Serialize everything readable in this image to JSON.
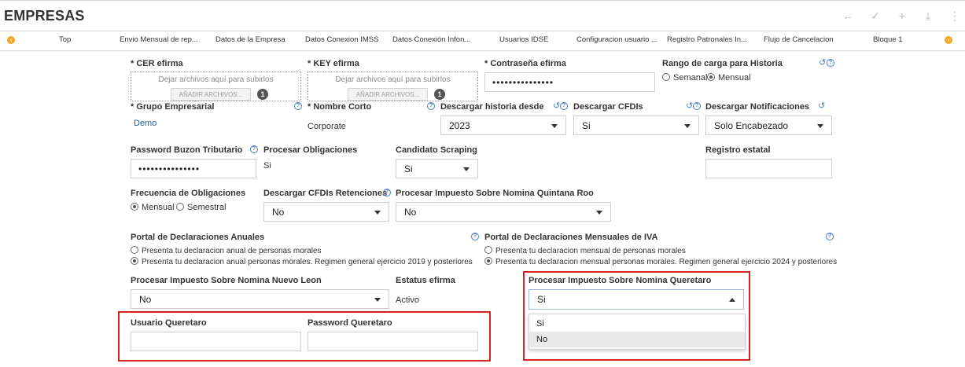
{
  "header": {
    "title": "EMPRESAS",
    "icons": [
      "arrow-left-icon",
      "check-icon",
      "plus-icon",
      "download-icon",
      "more-vertical-icon"
    ]
  },
  "tabs": [
    "Top",
    "Envio Mensual de rep...",
    "Datos de la Empresa",
    "Datos Conexion IMSS",
    "Datos Conexión Infon...",
    "Usuarios IDSE",
    "Configuracion usuario ...",
    "Registro Patronales In...",
    "Flujo de Cancelacion",
    "Bloque 1"
  ],
  "form": {
    "cer": {
      "label": "* CER efirma",
      "drop_text": "Dejar archivos aquí para subirlos",
      "button": "AÑADIR ARCHIVOS...",
      "count": "1"
    },
    "key": {
      "label": "* KEY efirma",
      "drop_text": "Dejar archivos aquí para subirlos",
      "button": "AÑADIR ARCHIVOS...",
      "count": "1"
    },
    "contrasena": {
      "label": "* Contraseña efirma",
      "value": "•••••••••••••••"
    },
    "rango": {
      "label": "Rango de carga para Historia",
      "opt1": "Semanal",
      "opt2": "Mensual"
    },
    "grupo": {
      "label": "* Grupo Empresarial",
      "value": "Demo"
    },
    "nombre_corto": {
      "label": "* Nombre Corto",
      "value": "Corporate"
    },
    "descargar_historia": {
      "label": "Descargar historia desde",
      "value": "2023"
    },
    "descargar_cfdis": {
      "label": "Descargar CFDIs",
      "value": "Si"
    },
    "descargar_notificaciones": {
      "label": "Descargar Notificaciones",
      "value": "Solo Encabezado"
    },
    "password_buzon": {
      "label": "Password Buzon Tributario",
      "value": "•••••••••••••••"
    },
    "procesar_obligaciones": {
      "label": "Procesar Obligaciones",
      "value": "Si"
    },
    "candidato_scraping": {
      "label": "Candidato Scraping",
      "value": "Si"
    },
    "registro_estatal": {
      "label": "Registro estatal",
      "value": ""
    },
    "frecuencia": {
      "label": "Frecuencia de Obligaciones",
      "opt1": "Mensual",
      "opt2": "Semestral"
    },
    "cfdis_retenciones": {
      "label": "Descargar CFDIs Retenciones",
      "value": "No"
    },
    "isn_qroo": {
      "label": "Procesar Impuesto Sobre Nomina Quintana Roo",
      "value": "No"
    },
    "portal_anuales": {
      "label": "Portal de Declaraciones Anuales",
      "opt1": "Presenta tu declaracion anual de personas morales",
      "opt2": "Presenta tu declaracion anual personas morales. Regimen general ejercicio 2019 y posteriores"
    },
    "portal_mensuales": {
      "label": "Portal de Declaraciones Mensuales de IVA",
      "opt1": "Presenta tu declaracion mensual de personas morales",
      "opt2": "Presenta tu declaracion mensual personas morales. Regimen general ejercicio 2024 y posteriores"
    },
    "isn_nuevo_leon": {
      "label": "Procesar Impuesto Sobre Nomina Nuevo Leon",
      "value": "No"
    },
    "estatus_efirma": {
      "label": "Estatus efirma",
      "value": "Activo"
    },
    "isn_queretaro": {
      "label": "Procesar Impuesto Sobre Nomina Queretaro",
      "value": "Si",
      "options": [
        "Si",
        "No"
      ]
    },
    "usuario_queretaro": {
      "label": "Usuario Queretaro",
      "value": ""
    },
    "password_queretaro": {
      "label": "Password Queretaro",
      "value": ""
    }
  },
  "colors": {
    "highlight_border": "#d32222",
    "accent_orange": "#f5a623",
    "help_blue": "#4a7ec2"
  }
}
